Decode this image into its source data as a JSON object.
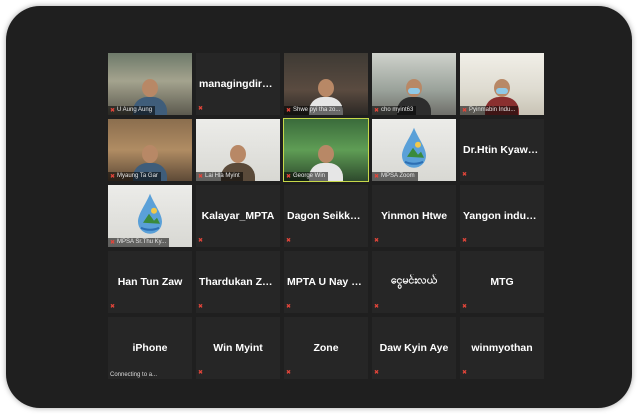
{
  "participants": [
    {
      "row": 1,
      "label": "U Aung Aung",
      "tile_text": "",
      "video": "outdoor"
    },
    {
      "row": 1,
      "label": "",
      "tile_text": "managingdirecc...",
      "video": ""
    },
    {
      "row": 1,
      "label": "Shwe pyi tha zo...",
      "tile_text": "",
      "video": "dark"
    },
    {
      "row": 1,
      "label": "cho myint63",
      "tile_text": "",
      "video": "room"
    },
    {
      "row": 1,
      "label": "Pyinmabin Indu...",
      "tile_text": "",
      "video": "bright"
    },
    {
      "row": 2,
      "label": "Myaung Ta Gar",
      "tile_text": "",
      "video": "wood"
    },
    {
      "row": 2,
      "label": "Lai Hla Myint",
      "tile_text": "",
      "video": "white"
    },
    {
      "row": 2,
      "label": "George Win",
      "tile_text": "",
      "video": "green",
      "active": true
    },
    {
      "row": 2,
      "label": "MPSA Zoom",
      "tile_text": "",
      "video": "logo"
    },
    {
      "row": 2,
      "label": "",
      "tile_text": "Dr.Htin Kyaw O...",
      "video": ""
    },
    {
      "row": 3,
      "label": "MPSA Sr.Thu Ky...",
      "tile_text": "",
      "video": "logo"
    },
    {
      "row": 3,
      "label": "",
      "tile_text": "Kalayar_MPTA",
      "video": ""
    },
    {
      "row": 3,
      "label": "",
      "tile_text": "Dagon  Seikkan...",
      "video": ""
    },
    {
      "row": 3,
      "label": "",
      "tile_text": "Yinmon Htwe",
      "video": ""
    },
    {
      "row": 3,
      "label": "",
      "tile_text": "Yangon  industri...",
      "video": ""
    },
    {
      "row": 4,
      "label": "",
      "tile_text": "Han Tun Zaw",
      "video": ""
    },
    {
      "row": 4,
      "label": "",
      "tile_text": "Thardukan Zone",
      "video": ""
    },
    {
      "row": 4,
      "label": "",
      "tile_text": "MPTA  U Nay W...",
      "video": ""
    },
    {
      "row": 4,
      "label": "",
      "tile_text": "ငွေမင်းလယ်",
      "video": ""
    },
    {
      "row": 4,
      "label": "",
      "tile_text": "MTG",
      "video": ""
    },
    {
      "row": 5,
      "label": "",
      "tile_text": "iPhone",
      "video": "",
      "status": "Connecting to a..."
    },
    {
      "row": 5,
      "label": "",
      "tile_text": "Win Myint",
      "video": ""
    },
    {
      "row": 5,
      "label": "",
      "tile_text": "Zone",
      "video": ""
    },
    {
      "row": 5,
      "label": "",
      "tile_text": "Daw Kyin Aye",
      "video": ""
    },
    {
      "row": 5,
      "label": "",
      "tile_text": "winmyothan",
      "video": ""
    }
  ],
  "colors": {
    "frame_bg": "#1f1f1f",
    "tile_bg": "#262626",
    "active_border": "#c7d84a",
    "muted_icon": "#e2453a"
  },
  "icons": {
    "muted": "mic-muted-icon"
  }
}
